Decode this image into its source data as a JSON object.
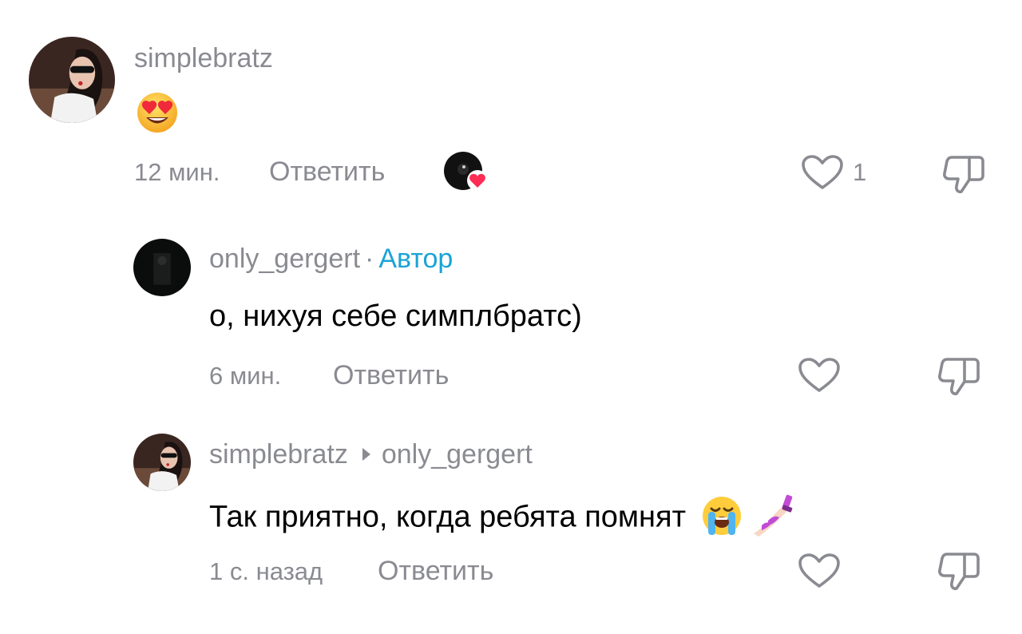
{
  "comments": [
    {
      "username": "simplebratz",
      "time": "12 мин.",
      "reply_label": "Ответить",
      "likes": "1",
      "emoji": "heart-eyes-emoji",
      "creator_liked": true
    },
    {
      "username": "only_gergert",
      "separator": "·",
      "author_badge": "Автор",
      "text": "о, нихуя себе симплбратс)",
      "time": "6 мин.",
      "reply_label": "Ответить"
    },
    {
      "username": "simplebratz",
      "reply_to": "only_gergert",
      "text": "Так приятно, когда ребята помнят",
      "emojis": [
        "loudly-crying-emoji",
        "nail-polish-emoji"
      ],
      "time": "1 с. назад",
      "reply_label": "Ответить"
    }
  ],
  "colors": {
    "muted": "#8a8b91",
    "author": "#1aa3d6",
    "heart": "#fe2c55"
  }
}
